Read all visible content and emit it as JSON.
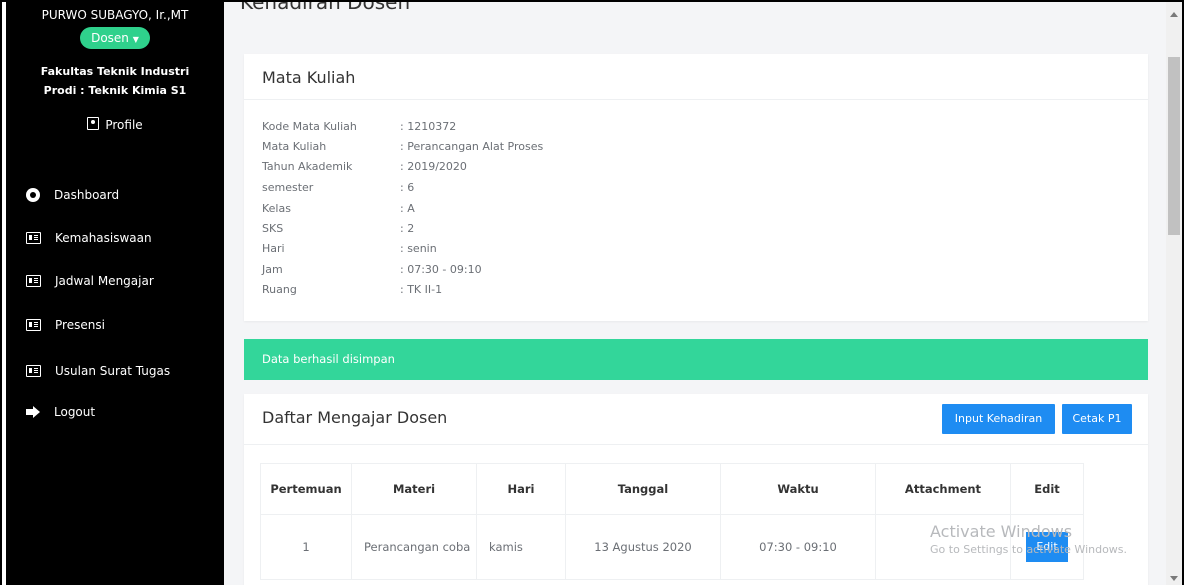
{
  "sidebar": {
    "user_name": "PURWO SUBAGYO, Ir.,MT",
    "role_label": "Dosen",
    "faculty": "Fakultas Teknik Industri",
    "program": "Prodi : Teknik Kimia S1",
    "profile_label": "Profile",
    "nav": [
      {
        "label": "Dashboard",
        "icon": "dashboard-icon"
      },
      {
        "label": "Kemahasiswaan",
        "icon": "id-card-icon"
      },
      {
        "label": "Jadwal Mengajar",
        "icon": "id-card-icon"
      },
      {
        "label": "Presensi",
        "icon": "id-card-icon"
      },
      {
        "label": "Usulan Surat Tugas",
        "icon": "id-card-icon"
      },
      {
        "label": "Logout",
        "icon": "logout-icon"
      }
    ]
  },
  "page": {
    "title": "Kehadiran Dosen"
  },
  "course": {
    "title": "Mata Kuliah",
    "fields": [
      {
        "label": "Kode Mata Kuliah",
        "value": ": 1210372"
      },
      {
        "label": "Mata Kuliah",
        "value": ": Perancangan Alat Proses"
      },
      {
        "label": "Tahun Akademik",
        "value": ": 2019/2020"
      },
      {
        "label": "semester",
        "value": ": 6"
      },
      {
        "label": "Kelas",
        "value": ": A"
      },
      {
        "label": "SKS",
        "value": ": 2"
      },
      {
        "label": "Hari",
        "value": ": senin"
      },
      {
        "label": "Jam",
        "value": ": 07:30 - 09:10"
      },
      {
        "label": "Ruang",
        "value": ": TK II-1"
      }
    ]
  },
  "alert": {
    "message": "Data berhasil disimpan",
    "color": "#33d69a"
  },
  "teaching": {
    "title": "Daftar Mengajar Dosen",
    "input_button": "Input Kehadiran",
    "print_button": "Cetak P1",
    "columns": [
      "Pertemuan",
      "Materi",
      "Hari",
      "Tanggal",
      "Waktu",
      "Attachment",
      "Edit"
    ],
    "rows": [
      {
        "pertemuan": "1",
        "materi": "Perancangan coba",
        "hari": "kamis",
        "tanggal": "13 Agustus 2020",
        "waktu": "07:30 - 09:10",
        "attachment": "",
        "edit": "Edit"
      }
    ]
  },
  "watermark": {
    "line1": "Activate Windows",
    "line2": "Go to Settings to activate Windows."
  },
  "colors": {
    "accent": "#1e8cf2",
    "sidebar_bg": "#000000",
    "role_badge": "#2fd18c"
  }
}
